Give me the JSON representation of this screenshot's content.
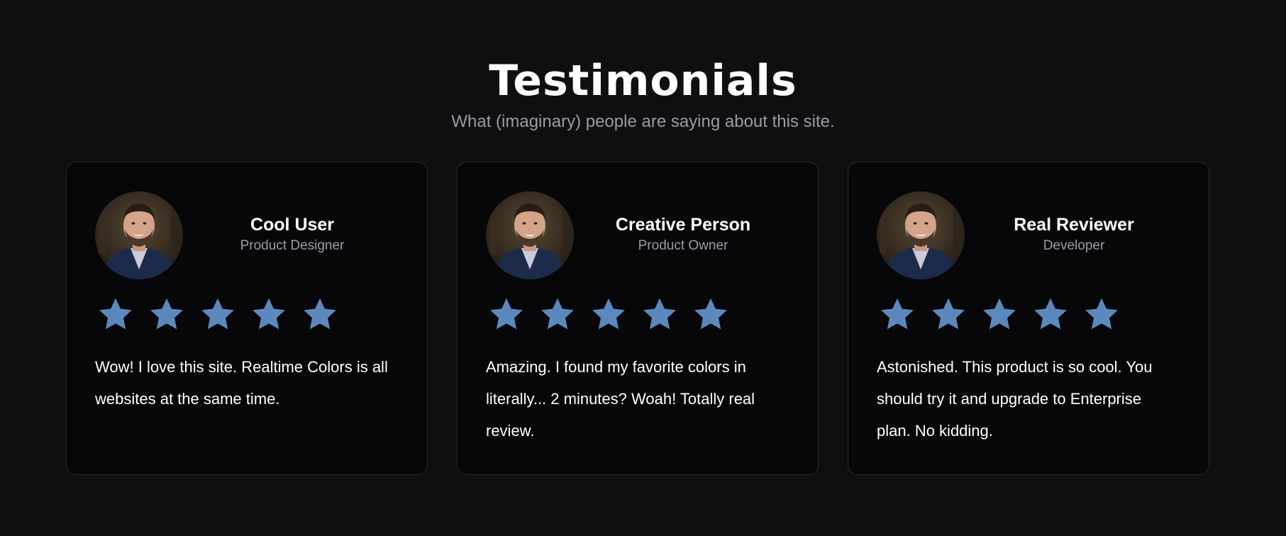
{
  "header": {
    "title": "Testimonials",
    "subtitle": "What (imaginary) people are saying about this site."
  },
  "colors": {
    "background": "#0e0f11",
    "card_background": "#070709",
    "card_border": "#2a2b30",
    "star": "#5b89bd",
    "muted_text": "#9a9ca3"
  },
  "testimonials": [
    {
      "name": "Cool User",
      "role": "Product Designer",
      "rating": 5,
      "quote": "Wow! I love this site. Realtime Colors is all websites at the same time."
    },
    {
      "name": "Creative Person",
      "role": "Product Owner",
      "rating": 5,
      "quote": "Amazing. I found my favorite colors in literally... 2 minutes? Woah! Totally real review."
    },
    {
      "name": "Real Reviewer",
      "role": "Developer",
      "rating": 5,
      "quote": "Astonished. This product is so cool. You should try it and upgrade to Enterprise plan. No kidding."
    }
  ]
}
